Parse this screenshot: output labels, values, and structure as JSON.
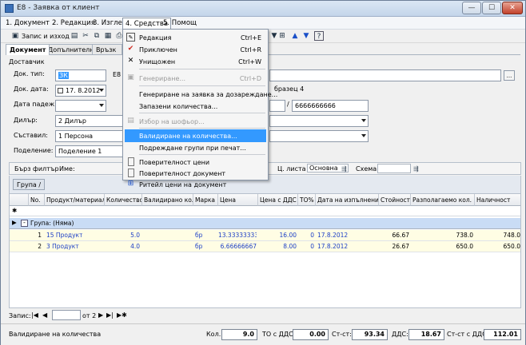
{
  "window": {
    "title": "E8 - Заявка от клиент",
    "min": "—",
    "max": "☐",
    "close": "✕"
  },
  "menubar": {
    "items": [
      "1. Документ",
      "2. Редакция",
      "3. Изглед",
      "4. Средства",
      "5. Помощ"
    ]
  },
  "toolbar": {
    "save_exit": "Запис и изход"
  },
  "tabs": [
    "Документ",
    "Допълнителни",
    "Връзк"
  ],
  "form": {
    "section": "Доставчик",
    "doc_type_label": "Док. тип:",
    "doc_type_value": "ЗК",
    "doc_type_extra": "E8",
    "doc_date_label": "Док. дата:",
    "doc_date_value": "17.  8.2012",
    "due_date_label": "Дата падеж:",
    "dealer_label": "Дилър:",
    "dealer_value": "2 Дилър",
    "composer_label": "Съставил:",
    "composer_value": "1 Персона",
    "division_label": "Поделение:",
    "division_value": "Поделение 1",
    "right_text": "бразец 4",
    "slash": "/",
    "number_value": "6666666666",
    "browse": "..."
  },
  "gridbar": {
    "quick_filter": "Бърз филтър",
    "name_label": "Име:",
    "price_list_label": "Ц. листа",
    "price_list_value": "Основна",
    "scheme_label": "Схема"
  },
  "group_tag": "Група /",
  "columns": [
    "No.",
    "Продукт/материал",
    "Количество",
    "Валидирано кол.",
    "Марка",
    "Цена",
    "Цена с ДДС",
    "ТО%",
    "Дата на изпълнение",
    "Стойност",
    "Разполагаемо кол.",
    "Наличност"
  ],
  "group_row": "Група: (Няма)",
  "rows": [
    {
      "no": "1",
      "product": "15 Продукт",
      "qty": "5.0",
      "validated": "",
      "brand": "бр",
      "price": "13.33333333",
      "price_vat": "16.00",
      "to": "0",
      "date": "17.8.2012",
      "value": "66.67",
      "available": "738.0",
      "stock": "748.0"
    },
    {
      "no": "2",
      "product": "3 Продукт",
      "qty": "4.0",
      "validated": "",
      "brand": "бр",
      "price": "6.66666667",
      "price_vat": "8.00",
      "to": "0",
      "date": "17.8.2012",
      "value": "26.67",
      "available": "650.0",
      "stock": "650.0"
    }
  ],
  "nav": {
    "record_label": "Запис:",
    "of_label": "от 2"
  },
  "status": {
    "text": "Валидиране на количества",
    "qty_label": "Кол.",
    "qty_value": "9.0",
    "to_label": "ТО с ДДС:",
    "to_value": "0.00",
    "cost_label": "Ст-ст:",
    "cost_value": "93.34",
    "vat_label": "ДДС:",
    "vat_value": "18.67",
    "total_label": "Ст-ст с ДДС:",
    "total_value": "112.01"
  },
  "menu": {
    "items": [
      {
        "label": "Редакция",
        "shortcut": "Ctrl+E",
        "icon": "edit-icon",
        "state": "normal"
      },
      {
        "label": "Приключен",
        "shortcut": "Ctrl+R",
        "icon": "check-icon",
        "state": "normal"
      },
      {
        "label": "Унищожен",
        "shortcut": "Ctrl+W",
        "icon": "x-icon",
        "state": "normal"
      },
      {
        "label": "Генериране...",
        "shortcut": "Ctrl+D",
        "icon": "generate-icon",
        "state": "disabled"
      },
      {
        "label": "Генериране на заявка за дозареждане...",
        "shortcut": "",
        "icon": "",
        "state": "normal"
      },
      {
        "label": "Запазени количества...",
        "shortcut": "",
        "icon": "",
        "state": "normal"
      },
      {
        "label": "Избор на шофьор...",
        "shortcut": "",
        "icon": "driver-icon",
        "state": "disabled"
      },
      {
        "label": "Валидиране на количества...",
        "shortcut": "",
        "icon": "",
        "state": "highlighted"
      },
      {
        "label": "Подреждане групи при печат...",
        "shortcut": "",
        "icon": "",
        "state": "normal"
      },
      {
        "label": "Поверителност цени",
        "shortcut": "",
        "icon": "doc-icon",
        "state": "normal"
      },
      {
        "label": "Поверителност документ",
        "shortcut": "",
        "icon": "doc-icon",
        "state": "normal"
      },
      {
        "label": "Ритейл цени на документ",
        "shortcut": "",
        "icon": "cart-icon",
        "state": "normal"
      }
    ]
  }
}
